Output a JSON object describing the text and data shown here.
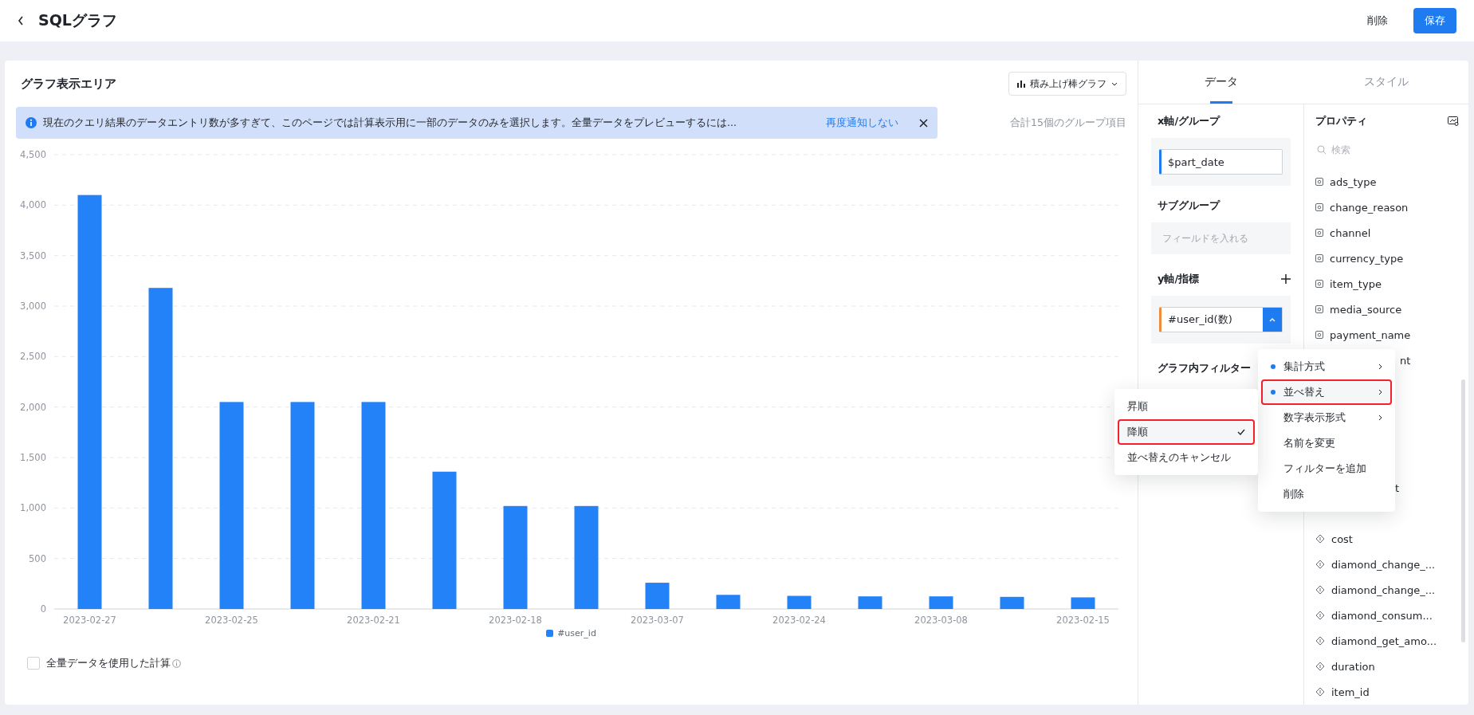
{
  "header": {
    "title": "SQLグラフ",
    "buttons": [
      {
        "label": "削除",
        "kind": "plain"
      },
      {
        "label": "保存",
        "kind": "primary"
      }
    ]
  },
  "chart_area": {
    "title": "グラフ表示エリア",
    "chart_type": "積み上げ棒グラフ",
    "notice": {
      "text": "現在のクエリ結果のデータエントリ数が多すぎて、このページでは計算表示用に一部のデータのみを選択します。全量データをプレビューするには...",
      "link": "再度通知しない"
    },
    "group_count": "合計15個のグループ項目",
    "chart_data": {
      "type": "bar",
      "grid": true,
      "ylim": [
        0,
        4500
      ],
      "yticks": [
        0,
        500,
        {
          "value": 1000,
          "label": "1,000"
        },
        {
          "value": 1500,
          "label": "1,500"
        },
        {
          "value": 2000,
          "label": "2,000"
        },
        {
          "value": 2500,
          "label": "2,500"
        },
        {
          "value": 3000,
          "label": "3,000"
        },
        {
          "value": 3500,
          "label": "3,500"
        },
        {
          "value": 4000,
          "label": "4,000"
        },
        {
          "value": 4500,
          "label": "4,500"
        }
      ],
      "categories": [
        "2023-02-27",
        null,
        "2023-02-25",
        null,
        "2023-02-21",
        null,
        "2023-02-18",
        null,
        "2023-03-07",
        null,
        "2023-02-24",
        null,
        "2023-03-08",
        null,
        "2023-02-15"
      ],
      "series": [
        {
          "name": "#user_id",
          "color": "#2382f8",
          "values": [
            4100,
            3180,
            2050,
            2050,
            2050,
            1360,
            1020,
            1020,
            260,
            140,
            130,
            125,
            125,
            120,
            115
          ]
        }
      ]
    },
    "full_data": {
      "label": "全量データを使用した計算",
      "checked": false
    }
  },
  "panel": {
    "tabs": [
      {
        "label": "データ",
        "selected": true
      },
      {
        "label": "スタイル",
        "selected": false
      }
    ],
    "x_axis": {
      "title": "x軸/グループ",
      "field": "$part_date"
    },
    "subgroup": {
      "title": "サブグループ",
      "placeholder": "フィールドを入れる"
    },
    "y_axis": {
      "title": "y軸/指標",
      "field": "#user_id(数)",
      "expanded": true
    },
    "filter": {
      "title": "グラフ内フィルター"
    },
    "properties": {
      "title": "プロパティ",
      "search_placeholder": "検索",
      "items": [
        {
          "name": "ads_type",
          "kind": "string"
        },
        {
          "name": "change_reason",
          "kind": "string"
        },
        {
          "name": "channel",
          "kind": "string"
        },
        {
          "name": "currency_type",
          "kind": "string"
        },
        {
          "name": "item_type",
          "kind": "string"
        },
        {
          "name": "media_source",
          "kind": "string"
        },
        {
          "name": "payment_name",
          "kind": "string"
        },
        {
          "name": "nt",
          "kind": "partial"
        },
        {
          "name": "t",
          "kind": "partial"
        },
        {
          "name": "cost",
          "kind": "number"
        },
        {
          "name": "diamond_change_...",
          "kind": "number"
        },
        {
          "name": "diamond_change_...",
          "kind": "number"
        },
        {
          "name": "diamond_consum...",
          "kind": "number"
        },
        {
          "name": "diamond_get_amo...",
          "kind": "number"
        },
        {
          "name": "duration",
          "kind": "number"
        },
        {
          "name": "item_id",
          "kind": "number"
        }
      ]
    }
  },
  "metric_menu": [
    {
      "label": "集計方式",
      "active": true,
      "submenu": true,
      "highlighted": false
    },
    {
      "label": "並べ替え",
      "active": true,
      "submenu": true,
      "highlighted": true
    },
    {
      "label": "数字表示形式",
      "active": false,
      "submenu": true,
      "highlighted": false
    },
    {
      "label": "名前を変更",
      "active": false,
      "submenu": false,
      "highlighted": false
    },
    {
      "label": "フィルターを追加",
      "active": false,
      "submenu": false,
      "highlighted": false
    },
    {
      "label": "削除",
      "active": false,
      "submenu": false,
      "highlighted": false
    }
  ],
  "sort_menu": [
    {
      "label": "昇順",
      "checked": false,
      "highlighted": false
    },
    {
      "label": "降順",
      "checked": true,
      "highlighted": true
    },
    {
      "label": "並べ替えのキャンセル",
      "checked": false,
      "highlighted": false
    }
  ]
}
